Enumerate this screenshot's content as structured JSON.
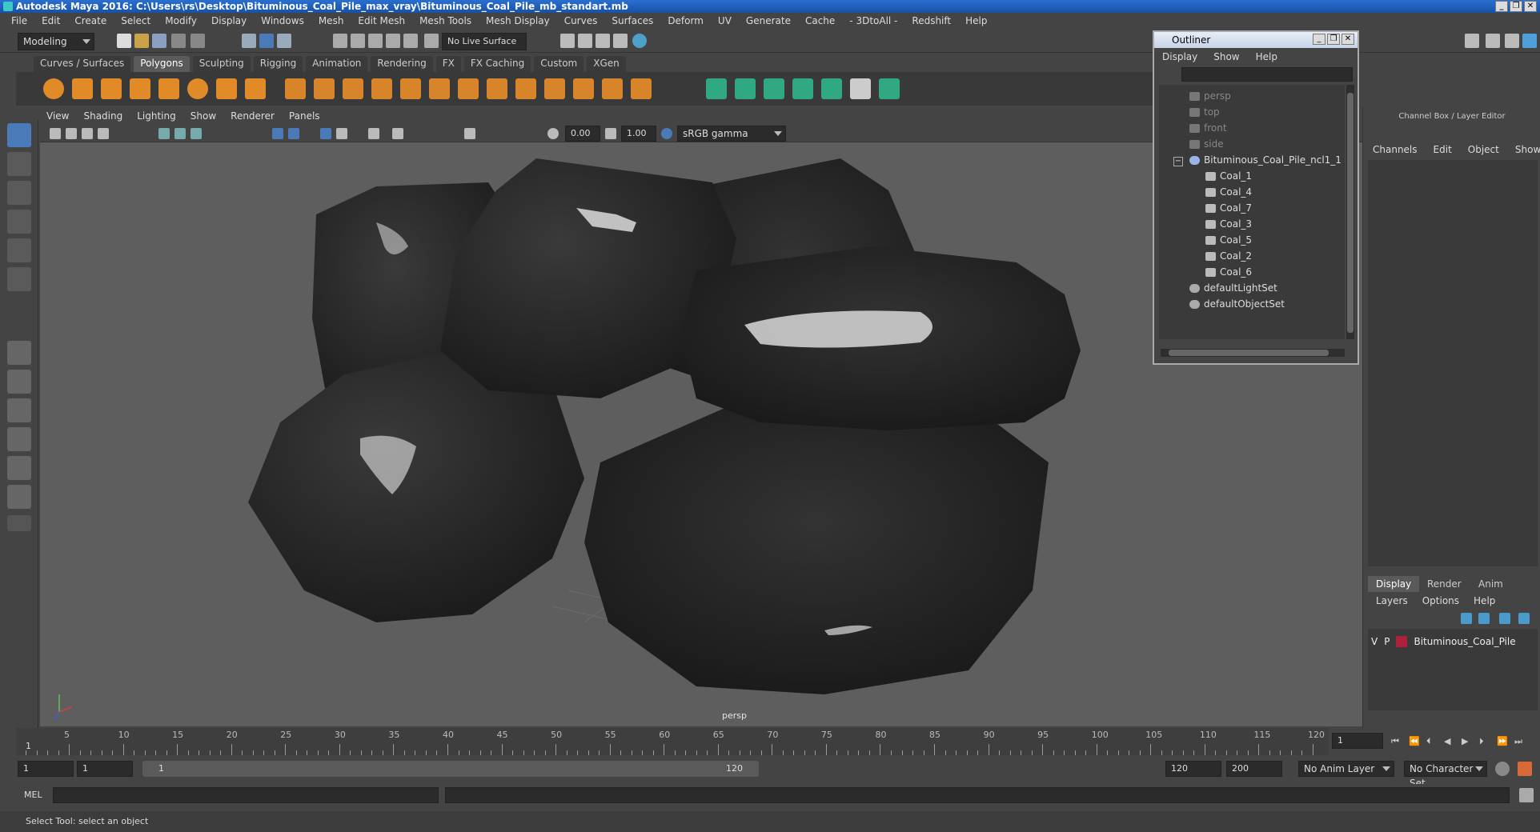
{
  "window": {
    "title": "Autodesk Maya 2016: C:\\Users\\rs\\Desktop\\Bituminous_Coal_Pile_max_vray\\Bituminous_Coal_Pile_mb_standart.mb",
    "min": "_",
    "max": "❐",
    "close": "✕"
  },
  "menus": [
    "File",
    "Edit",
    "Create",
    "Select",
    "Modify",
    "Display",
    "Windows",
    "Mesh",
    "Edit Mesh",
    "Mesh Tools",
    "Mesh Display",
    "Curves",
    "Surfaces",
    "Deform",
    "UV",
    "Generate",
    "Cache",
    "- 3DtoAll -",
    "Redshift",
    "Help"
  ],
  "statusline": {
    "mode": "Modeling",
    "live_surface": "No Live Surface"
  },
  "shelf_tabs": [
    "Curves / Surfaces",
    "Polygons",
    "Sculpting",
    "Rigging",
    "Animation",
    "Rendering",
    "FX",
    "FX Caching",
    "Custom",
    "XGen"
  ],
  "panel_menu": [
    "View",
    "Shading",
    "Lighting",
    "Show",
    "Renderer",
    "Panels"
  ],
  "panel_toolbar": {
    "exposure": "0.00",
    "gamma": "1.00",
    "color_space": "sRGB gamma"
  },
  "viewport": {
    "camera_label": "persp"
  },
  "outliner": {
    "title": "Outliner",
    "menus": [
      "Display",
      "Show",
      "Help"
    ],
    "cameras": [
      "persp",
      "top",
      "front",
      "side"
    ],
    "group": "Bituminous_Coal_Pile_ncl1_1",
    "children": [
      "Coal_1",
      "Coal_4",
      "Coal_7",
      "Coal_3",
      "Coal_5",
      "Coal_2",
      "Coal_6"
    ],
    "sets": [
      "defaultLightSet",
      "defaultObjectSet"
    ],
    "collapse": "−"
  },
  "channel_box": {
    "title": "Channel Box / Layer Editor",
    "menus": [
      "Channels",
      "Edit",
      "Object",
      "Show"
    ],
    "layer_tabs": [
      "Display",
      "Render",
      "Anim"
    ],
    "layer_menus": [
      "Layers",
      "Options",
      "Help"
    ],
    "layer": {
      "v": "V",
      "p": "P",
      "name": "Bituminous_Coal_Pile",
      "color": "#b0203a"
    }
  },
  "timeline": {
    "ticks": [
      "5",
      "10",
      "15",
      "20",
      "25",
      "30",
      "35",
      "40",
      "45",
      "50",
      "55",
      "60",
      "65",
      "70",
      "75",
      "80",
      "85",
      "90",
      "95",
      "100",
      "105",
      "110",
      "115",
      "120"
    ],
    "start_mark": "1",
    "current_frame": "1"
  },
  "range": {
    "start": "1",
    "playback_start": "1",
    "slider_start": "1",
    "slider_end": "120",
    "playback_end": "120",
    "end": "200",
    "anim_layer": "No Anim Layer",
    "character_set": "No Character Set"
  },
  "command_line": {
    "label": "MEL"
  },
  "help_line": "Select Tool: select an object"
}
